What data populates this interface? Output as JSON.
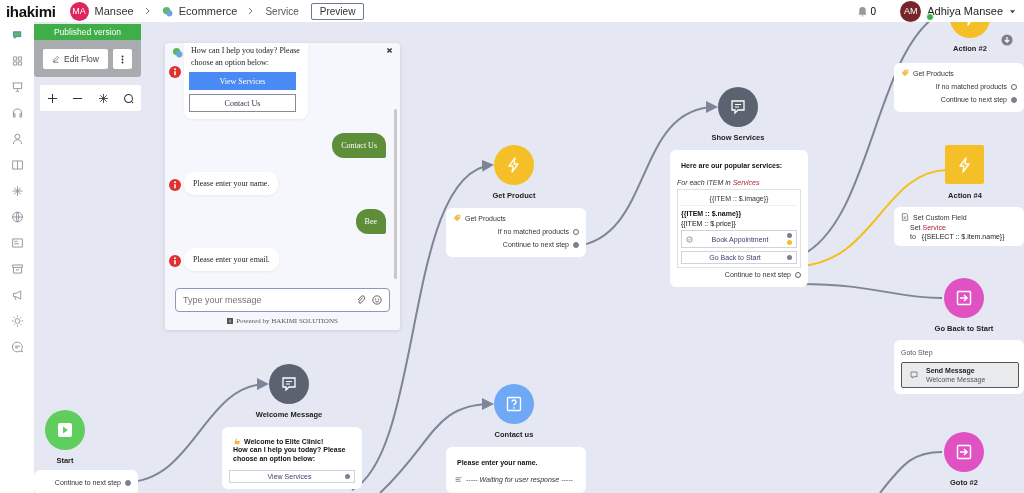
{
  "topbar": {
    "logo": "ihakimi",
    "workspace": {
      "initials": "MA",
      "name": "Mansee"
    },
    "breadcrumb": [
      "Ecommerce",
      "Service"
    ],
    "preview_button": "Preview",
    "notifications": "0",
    "user": {
      "initials": "AM",
      "name": "Adhiya Mansee",
      "online": true
    }
  },
  "left_panel": {
    "version": "Published version",
    "edit_button": "Edit Flow"
  },
  "chat": {
    "messages": [
      {
        "kind": "bot",
        "text": "How can I help you today? Please choose an option below:",
        "options": [
          {
            "label": "View Services",
            "highlighted": true
          },
          {
            "label": "Contact Us",
            "highlighted": false
          }
        ]
      },
      {
        "kind": "user",
        "text": "Contact Us"
      },
      {
        "kind": "bot",
        "text": "Please enter your name."
      },
      {
        "kind": "user",
        "text": "Bee"
      },
      {
        "kind": "bot",
        "text": "Please enter your email."
      }
    ],
    "input": {
      "placeholder": "Type your message"
    },
    "powered_by": "Powered by HAKIMI SOLUTIONS"
  },
  "nodes": [
    {
      "kind": "start",
      "label": "Start",
      "selected": false,
      "card": {
        "kind": "steps",
        "rows": [
          {
            "text": "Continue to next step",
            "connected": true
          }
        ]
      }
    },
    {
      "kind": "message",
      "label": "Welcome Message",
      "selected": false,
      "card": {
        "kind": "message",
        "title": "Welcome to Elite Clinic!",
        "text": "How can I help you today? Please choose an option below:",
        "buttons": [
          {
            "label": "View Services",
            "ports": [
              {
                "color": "#7a8091"
              }
            ]
          }
        ]
      }
    },
    {
      "kind": "action",
      "label": "Get Product",
      "selected": false,
      "card": {
        "kind": "get_products",
        "title": "Get Products",
        "rows": [
          {
            "text": "If no matched products",
            "connected": false
          },
          {
            "text": "Continue to next step",
            "connected": true
          }
        ]
      }
    },
    {
      "kind": "question",
      "label": "Contact us",
      "selected": false,
      "card": {
        "kind": "question",
        "text": "Please enter your name.",
        "waiting": "----- Waiting for user response -----"
      }
    },
    {
      "kind": "message",
      "label": "Show Services",
      "selected": false,
      "card": {
        "kind": "carousel",
        "text": "Here are our popular services:",
        "loop": "For each ITEM in",
        "loop_source": "Services",
        "image": "{{ITEM :: $.image}}",
        "name": "{{ITEM :: $.name}}",
        "price": "{{ITEM :: $.price}}",
        "buttons": [
          {
            "label": "Book Appointment",
            "ports": [
              {
                "color": "#7a8091"
              },
              {
                "color": "#f2c01e"
              }
            ]
          },
          {
            "label": "Go Back to Start",
            "ports": [
              {
                "color": "#7a8091"
              }
            ]
          }
        ],
        "rows": [
          {
            "text": "Continue to next step",
            "connected": false
          }
        ]
      }
    },
    {
      "kind": "action",
      "label": "Action #2",
      "selected": false,
      "card": {
        "kind": "get_products",
        "title": "Get Products",
        "rows": [
          {
            "text": "If no matched products",
            "connected": false
          },
          {
            "text": "Continue to next step",
            "connected": true
          }
        ]
      }
    },
    {
      "kind": "action",
      "label": "Action #4",
      "selected": true,
      "card": {
        "kind": "set_field",
        "title": "Set Custom Field",
        "set_word": "Set",
        "field": "Service",
        "to_word": "to",
        "value": "{{SELECT :: $.item.name}}"
      }
    },
    {
      "kind": "goto",
      "label": "Go Back to Start",
      "selected": false,
      "card": {
        "kind": "goto",
        "title": "Goto Step",
        "target": "Send Message",
        "target_sub": "Welcome Message"
      }
    },
    {
      "kind": "goto",
      "label": "Goto #2",
      "selected": false
    }
  ]
}
